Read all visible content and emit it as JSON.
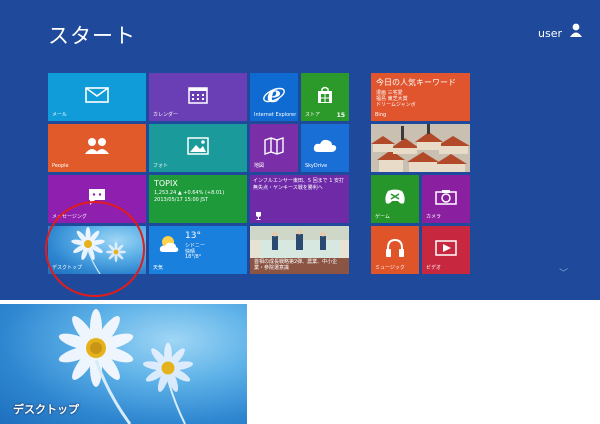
{
  "screen": {
    "title": "スタート",
    "user_name": "user"
  },
  "tiles": {
    "mail": {
      "label": "メール"
    },
    "calendar": {
      "label": "カレンダー"
    },
    "ie": {
      "label": "Internet Explorer"
    },
    "store": {
      "label": "ストア",
      "badge": "15"
    },
    "people": {
      "label": "People"
    },
    "photos": {
      "label": "フォト"
    },
    "maps": {
      "label": "地図"
    },
    "skydrive": {
      "label": "SkyDrive"
    },
    "messaging": {
      "label": "メッセージング"
    },
    "finance": {
      "heading": "TOPIX",
      "line1": "1,253.24 ▲ +0.64% (+8.01)",
      "line2": "2013/05/17 15:00 JST"
    },
    "sports": {
      "text": "インフルエンサー東田、5 回まで 1 安打無失点・ヤンキース戦を勝利へ"
    },
    "desktop": {
      "label": "デスクトップ"
    },
    "weather": {
      "temp": "13°",
      "city": "シドニー",
      "condition": "快晴",
      "range": "18°/8°",
      "label": "天気"
    },
    "news": {
      "text": "首相の成長戦略第2弾、農業、中小企業・参院選意識"
    },
    "bing": {
      "heading": "今日の人気キーワード",
      "line1": "漫画 三宅愛",
      "line2": "福島 東芝大賞",
      "line3": "ドリームジャンボ",
      "label": "Bing"
    },
    "travel": {},
    "games": {
      "label": "ゲーム"
    },
    "camera": {
      "label": "カメラ"
    },
    "music": {
      "label": "ミュージック"
    },
    "video": {
      "label": "ビデオ"
    }
  },
  "zoom": {
    "label": "デスクトップ"
  },
  "colors": {
    "background": "#1f4a9c",
    "mail": "#0f9cd8",
    "calendar": "#6a3fb5",
    "ie": "#0f6bd2",
    "store": "#2b9a2b",
    "people": "#e05a2a",
    "photos": "#1a9a9a",
    "maps": "#7a2fa8",
    "skydrive": "#1a6fd6",
    "messaging": "#8f1fae",
    "finance": "#1f9a3a",
    "sports": "#6f2aa8",
    "weather": "#1a80de",
    "bing": "#e0542e",
    "games": "#26962a",
    "camera": "#8a1fa0",
    "music": "#e0542a",
    "video": "#c7283f",
    "highlight": "#e21b1b"
  }
}
